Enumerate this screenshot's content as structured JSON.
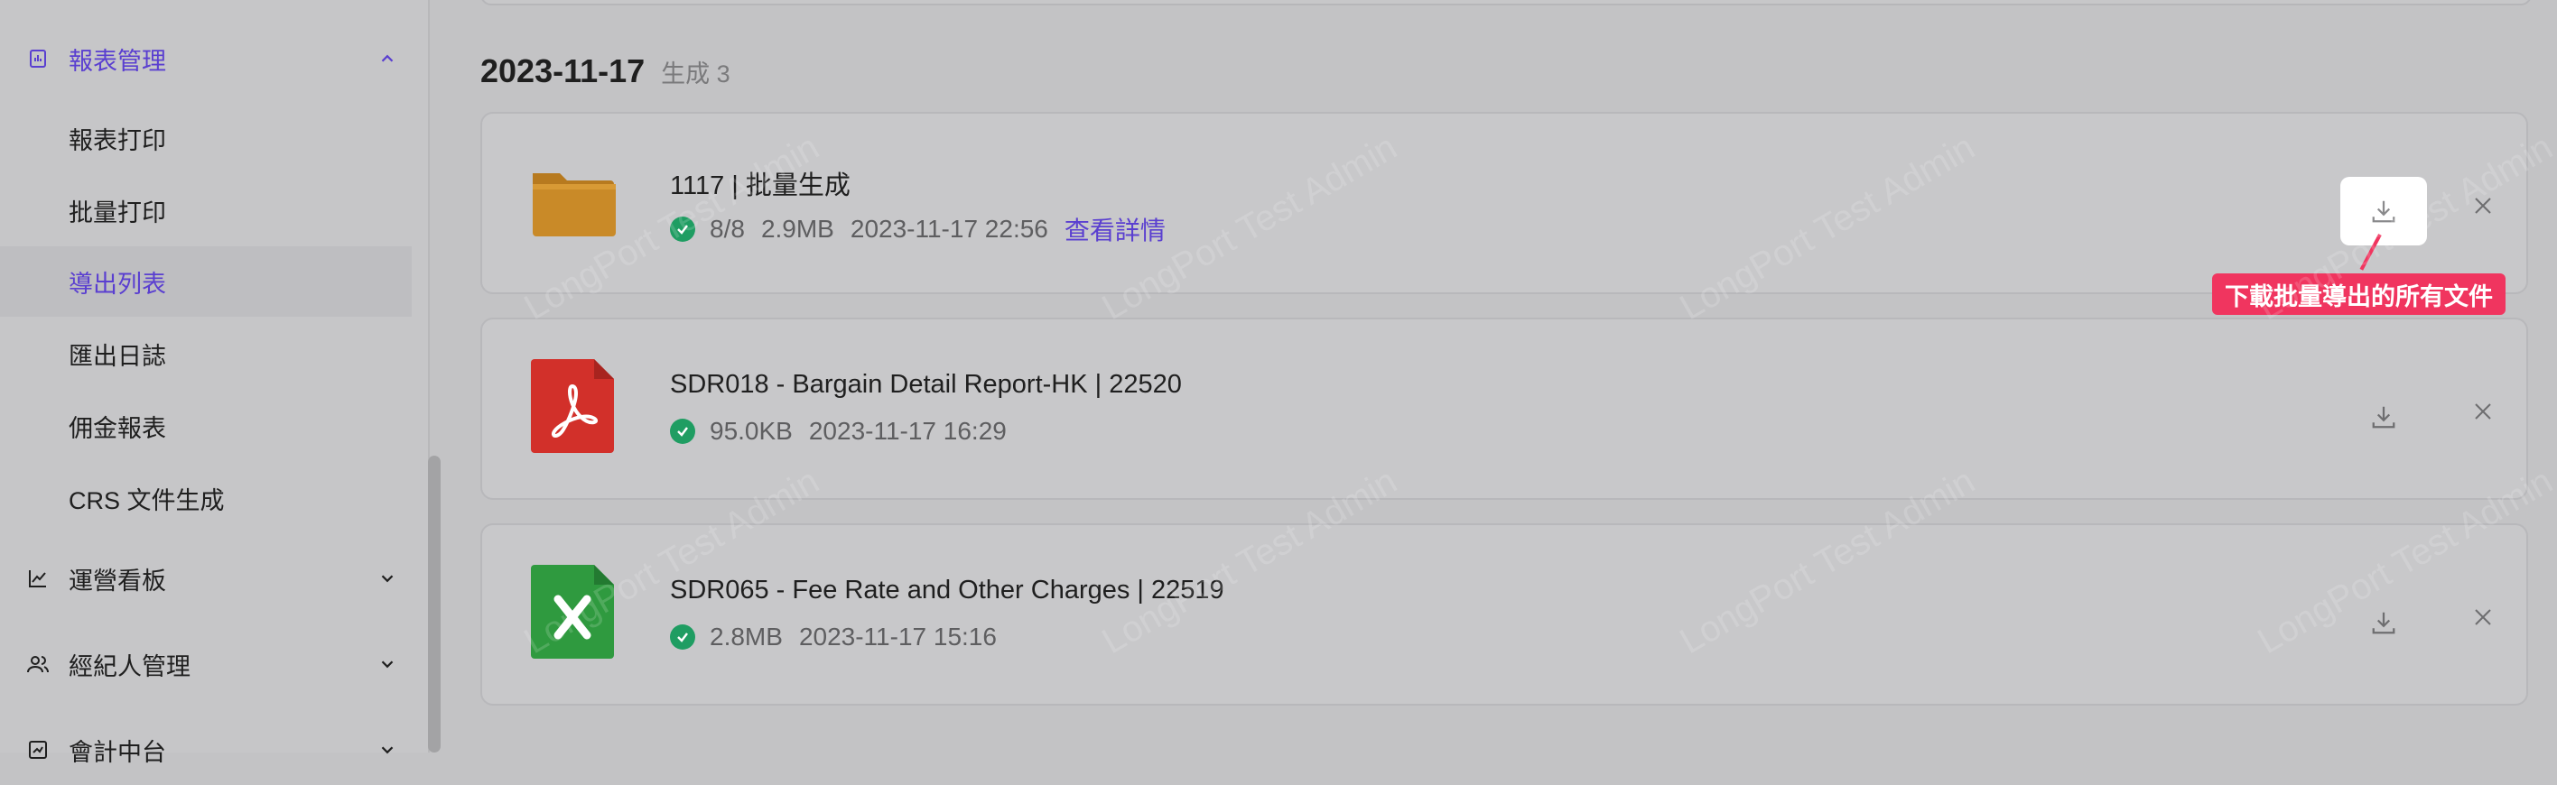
{
  "sidebar": {
    "report_mgmt_label": "報表管理",
    "sub_items": [
      {
        "label": "報表打印"
      },
      {
        "label": "批量打印"
      },
      {
        "label": "導出列表"
      },
      {
        "label": "匯出日誌"
      },
      {
        "label": "佣金報表"
      },
      {
        "label": "CRS 文件生成"
      }
    ],
    "ops_dashboard_label": "運營看板",
    "broker_mgmt_label": "經紀人管理",
    "accounting_label": "會計中台"
  },
  "group": {
    "date": "2023-11-17",
    "count_text": "生成 3"
  },
  "files": [
    {
      "type": "folder",
      "title": "1117 | 批量生成",
      "progress": "8/8",
      "size": "2.9MB",
      "time": "2023-11-17 22:56",
      "link": "查看詳情"
    },
    {
      "type": "pdf",
      "title": "SDR018 - Bargain Detail Report-HK | 22520",
      "size": "95.0KB",
      "time": "2023-11-17 16:29"
    },
    {
      "type": "excel",
      "title": "SDR065 - Fee Rate and Other Charges | 22519",
      "size": "2.8MB",
      "time": "2023-11-17 15:16"
    }
  ],
  "tooltip": "下載批量導出的所有文件",
  "watermark": "LongPort Test Admin",
  "colors": {
    "accent": "#5a3fd0",
    "success": "#1f9d62",
    "tooltip": "#f0355f",
    "folder": "#c98a28",
    "pdf": "#d2302a",
    "excel": "#2f9a3f"
  }
}
